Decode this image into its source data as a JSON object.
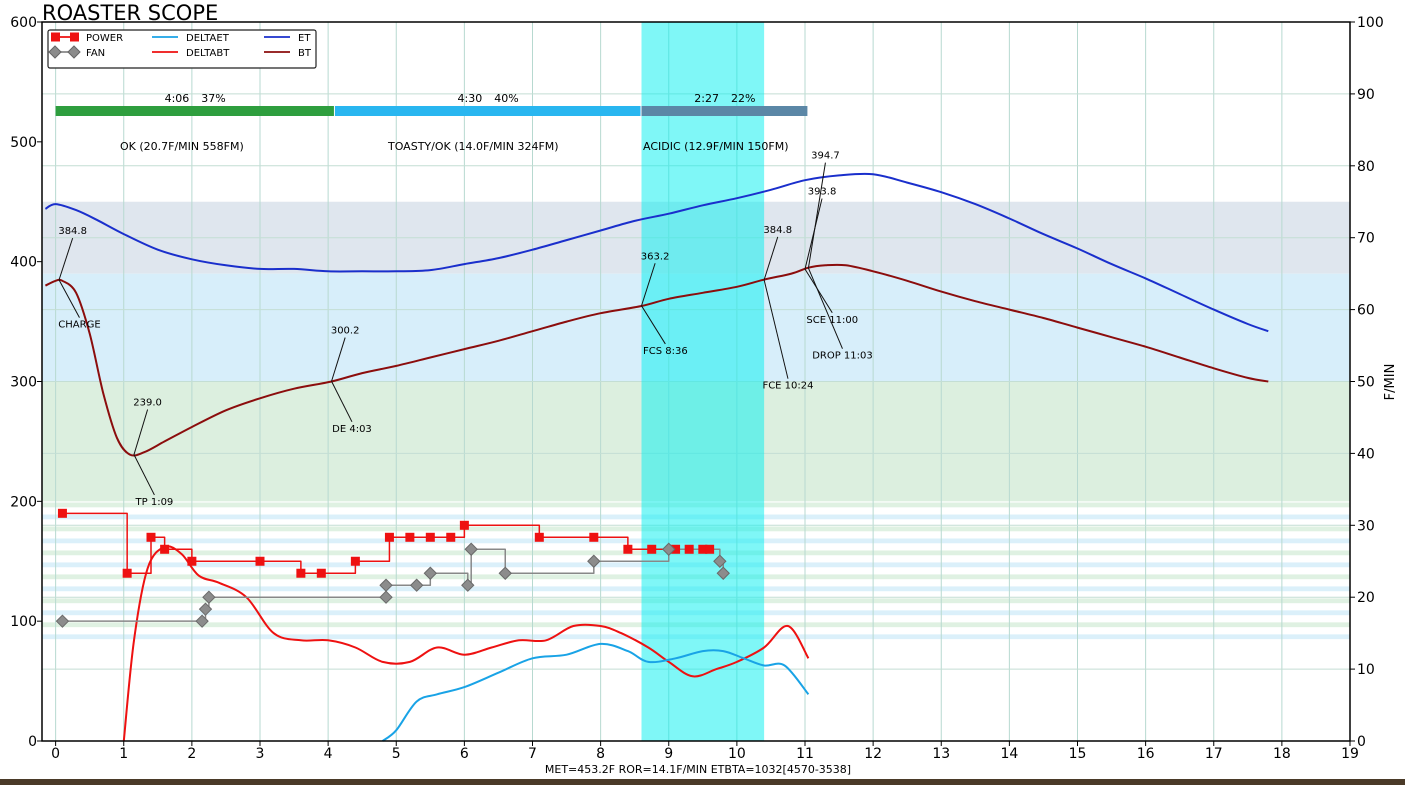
{
  "window": {
    "title": "ROASTER SCOPE"
  },
  "footer": {
    "readout": "MET=453.2F    ROR=14.1F/MIN    ETBTA=1032[4570-3538]"
  },
  "colors": {
    "background": "#ffffff",
    "frame_bottom": "#4a3a28",
    "power": "#ee1111",
    "fan": "#888888",
    "deltaet": "#19a3e6",
    "deltabt": "#ee1111",
    "et": "#1a2fcc",
    "bt": "#8b0d0d",
    "dev_band": "#00f0f0",
    "phase_drying": "#2e9e3e",
    "phase_maillard": "#29b6f0",
    "phase_finishing": "#5b87a6",
    "bg_band_top": "#dfe6ee",
    "bg_band_mid": "#d7eefa",
    "bg_band_low": "#dcefdf"
  },
  "chart_data": {
    "type": "line",
    "title": "ROASTER SCOPE",
    "xlabel": "",
    "ylabel": "",
    "y2label": "F/MIN",
    "xlim": [
      -0.2,
      19
    ],
    "ylim": [
      0,
      600
    ],
    "y2lim": [
      0,
      100
    ],
    "grid": true,
    "x_ticks": [
      0,
      1,
      2,
      3,
      4,
      5,
      6,
      7,
      8,
      9,
      10,
      11,
      12,
      13,
      14,
      15,
      16,
      17,
      18,
      19
    ],
    "y_ticks": [
      0,
      100,
      200,
      300,
      400,
      500,
      600
    ],
    "y2_ticks": [
      0,
      10,
      20,
      30,
      40,
      50,
      60,
      70,
      80,
      90,
      100
    ],
    "legend": {
      "position": "top-left",
      "items": [
        {
          "label": "POWER",
          "series": "power",
          "marker": "square"
        },
        {
          "label": "FAN",
          "series": "fan",
          "marker": "diamond"
        },
        {
          "label": "DELTAET",
          "series": "deltaet"
        },
        {
          "label": "DELTABT",
          "series": "deltabt"
        },
        {
          "label": "ET",
          "series": "et"
        },
        {
          "label": "BT",
          "series": "bt"
        }
      ]
    },
    "development_band": {
      "x_start": 8.6,
      "x_end": 10.4
    },
    "background_bands": [
      {
        "y0": 390,
        "y1": 450,
        "color": "bg_band_top"
      },
      {
        "y0": 300,
        "y1": 390,
        "color": "bg_band_mid"
      },
      {
        "y0": 200,
        "y1": 300,
        "color": "bg_band_low"
      }
    ],
    "phases": [
      {
        "time": "4:06",
        "pct": "37%",
        "x_start": 0,
        "x_end": 4.1,
        "color": "phase_drying",
        "summary": "OK (20.7F/MIN   558FM)"
      },
      {
        "time": "4:30",
        "pct": "40%",
        "x_start": 4.1,
        "x_end": 8.6,
        "color": "phase_maillard",
        "summary": "TOASTY/OK (14.0F/MIN   324FM)"
      },
      {
        "time": "2:27",
        "pct": "22%",
        "x_start": 8.6,
        "x_end": 11.05,
        "color": "phase_finishing",
        "summary": "ACIDIC (12.9F/MIN   150FM)"
      }
    ],
    "series": [
      {
        "name": "ET",
        "key": "et",
        "axis": "left",
        "x": [
          -0.15,
          0,
          0.3,
          0.6,
          1,
          1.5,
          2,
          2.5,
          3,
          3.5,
          4,
          4.5,
          5,
          5.5,
          6,
          6.5,
          7,
          7.5,
          8,
          8.5,
          9,
          9.5,
          10,
          10.5,
          11,
          11.5,
          12,
          12.5,
          13,
          13.5,
          14,
          14.5,
          15,
          15.5,
          16,
          16.5,
          17,
          17.5,
          17.8
        ],
        "y": [
          444,
          448,
          443,
          435,
          423,
          410,
          402,
          397,
          394,
          394,
          392,
          392,
          392,
          393,
          398,
          403,
          410,
          418,
          426,
          434,
          440,
          447,
          453,
          460,
          468,
          472,
          473,
          466,
          458,
          448,
          436,
          423,
          411,
          398,
          386,
          373,
          360,
          348,
          342
        ]
      },
      {
        "name": "BT",
        "key": "bt",
        "axis": "left",
        "x": [
          -0.15,
          0,
          0.1,
          0.3,
          0.5,
          0.7,
          0.9,
          1.09,
          1.3,
          1.6,
          2,
          2.5,
          3,
          3.5,
          4.05,
          4.5,
          5,
          5.5,
          6,
          6.5,
          7,
          7.5,
          8,
          8.6,
          9,
          9.5,
          10,
          10.4,
          10.8,
          11.05,
          11.3,
          11.6,
          12,
          12.5,
          13,
          13.5,
          14,
          14.5,
          15,
          15.5,
          16,
          16.5,
          17,
          17.5,
          17.8
        ],
        "y": [
          380,
          384,
          384,
          374,
          340,
          290,
          253,
          239,
          241,
          250,
          262,
          276,
          286,
          294,
          300,
          307,
          313,
          320,
          327,
          334,
          342,
          350,
          357,
          363,
          369,
          374,
          379,
          385,
          390,
          395,
          397,
          397,
          392,
          384,
          375,
          367,
          360,
          353,
          345,
          337,
          329,
          320,
          311,
          303,
          300
        ]
      },
      {
        "name": "DELTABT",
        "key": "deltabt",
        "axis": "right",
        "x": [
          1,
          1.15,
          1.35,
          1.6,
          1.85,
          2.1,
          2.4,
          2.8,
          3.2,
          3.6,
          4.0,
          4.4,
          4.8,
          5.2,
          5.6,
          6.0,
          6.4,
          6.8,
          7.2,
          7.6,
          8.0,
          8.3,
          8.7,
          9.0,
          9.35,
          9.7,
          10.0,
          10.4,
          10.75,
          11.05
        ],
        "y": [
          0,
          14,
          24,
          27,
          26,
          23,
          22,
          20,
          15,
          14,
          14,
          13,
          11,
          11,
          13,
          12,
          13,
          14,
          14,
          16,
          16,
          15,
          13,
          11,
          9,
          10,
          11,
          13,
          16,
          11.5
        ]
      },
      {
        "name": "DELTAET",
        "key": "deltaet",
        "axis": "right",
        "x": [
          4.8,
          5.0,
          5.3,
          5.6,
          6.0,
          6.5,
          7.0,
          7.5,
          8.0,
          8.4,
          8.7,
          9.1,
          9.5,
          9.8,
          10.1,
          10.4,
          10.7,
          11.05
        ],
        "y": [
          0,
          1.5,
          5.5,
          6.5,
          7.5,
          9.5,
          11.5,
          12,
          13.5,
          12.5,
          11,
          11.5,
          12.5,
          12.5,
          11.5,
          10.5,
          10.5,
          6.5
        ]
      },
      {
        "name": "POWER",
        "key": "power",
        "axis": "left",
        "x": [
          0.1,
          1.05,
          1.4,
          1.6,
          2.0,
          3.0,
          3.6,
          3.9,
          4.4,
          4.9,
          5.2,
          5.5,
          5.8,
          6.0,
          7.1,
          7.9,
          8.4,
          8.75,
          9.1,
          9.3,
          9.5,
          9.6
        ],
        "y": [
          190,
          140,
          170,
          160,
          150,
          150,
          140,
          140,
          150,
          170,
          170,
          170,
          170,
          180,
          170,
          170,
          160,
          160,
          160,
          160,
          160,
          160
        ]
      },
      {
        "name": "FAN",
        "key": "fan",
        "axis": "left",
        "x": [
          0.1,
          2.15,
          2.2,
          2.25,
          4.85,
          4.85,
          5.3,
          5.5,
          6.05,
          6.1,
          6.6,
          7.9,
          9.0,
          9.75,
          9.8
        ],
        "y": [
          100,
          100,
          110,
          120,
          120,
          130,
          130,
          140,
          130,
          160,
          140,
          150,
          160,
          150,
          140
        ]
      }
    ],
    "annotations": [
      {
        "label": "384.8",
        "x": 0.05,
        "y": 384.8,
        "tx": 0.25,
        "ty": 423,
        "anchor": "middle"
      },
      {
        "label": "CHARGE",
        "x": 0.05,
        "y": 384.8,
        "tx": 0.35,
        "ty": 345,
        "anchor": "middle"
      },
      {
        "label": "239.0",
        "x": 1.15,
        "y": 239,
        "tx": 1.35,
        "ty": 280,
        "anchor": "middle"
      },
      {
        "label": "TP 1:09",
        "x": 1.15,
        "y": 239,
        "tx": 1.45,
        "ty": 197,
        "anchor": "middle"
      },
      {
        "label": "300.2",
        "x": 4.05,
        "y": 300.2,
        "tx": 4.25,
        "ty": 340,
        "anchor": "middle"
      },
      {
        "label": "DE 4:03",
        "x": 4.05,
        "y": 300.2,
        "tx": 4.35,
        "ty": 258,
        "anchor": "middle"
      },
      {
        "label": "363.2",
        "x": 8.6,
        "y": 363.2,
        "tx": 8.8,
        "ty": 402,
        "anchor": "middle"
      },
      {
        "label": "FCS 8:36",
        "x": 8.6,
        "y": 363.2,
        "tx": 8.95,
        "ty": 323,
        "anchor": "middle"
      },
      {
        "label": "384.8",
        "x": 10.4,
        "y": 384.8,
        "tx": 10.6,
        "ty": 424,
        "anchor": "middle"
      },
      {
        "label": "FCE 10:24",
        "x": 10.4,
        "y": 384.8,
        "tx": 10.75,
        "ty": 294,
        "anchor": "middle"
      },
      {
        "label": "393.8",
        "x": 11.0,
        "y": 393.8,
        "tx": 11.25,
        "ty": 456,
        "anchor": "middle"
      },
      {
        "label": "SCE 11:00",
        "x": 11.0,
        "y": 393.8,
        "tx": 11.4,
        "ty": 349,
        "anchor": "middle"
      },
      {
        "label": "394.7",
        "x": 11.05,
        "y": 394.7,
        "tx": 11.3,
        "ty": 486,
        "anchor": "middle"
      },
      {
        "label": "DROP 11:03",
        "x": 11.05,
        "y": 394.7,
        "tx": 11.55,
        "ty": 319,
        "anchor": "middle"
      }
    ]
  }
}
